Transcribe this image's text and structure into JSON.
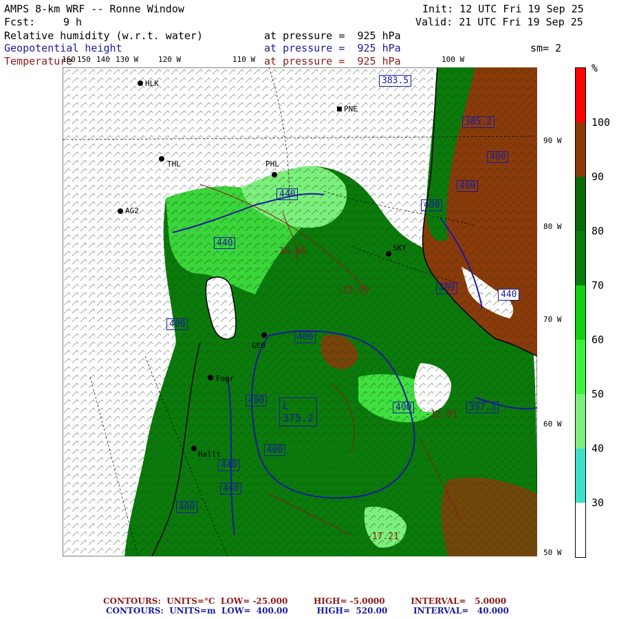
{
  "header": {
    "title": "AMPS 8-km WRF -- Ronne Window",
    "forecast_label": "Fcst:",
    "forecast_hours": "9 h",
    "init": "Init: 12 UTC Fri 19 Sep 25",
    "valid": "Valid: 21 UTC Fri 19 Sep 25",
    "smoothing": "sm= 2",
    "fields": [
      {
        "name": "Relative humidity (w.r.t. water)",
        "level": "at pressure =  925 hPa",
        "color": "#000000"
      },
      {
        "name": "Geopotential height",
        "level": "at pressure =  925 hPa",
        "color": "#1a1aa0"
      },
      {
        "name": "Temperature",
        "level": "at pressure =  925 hPa",
        "color": "#8b1a1a"
      }
    ]
  },
  "colorbar": {
    "unit": "%",
    "levels": [
      {
        "label": "30",
        "color": "#ffffff"
      },
      {
        "label": "40",
        "color": "#3fe0c8"
      },
      {
        "label": "50",
        "color": "#7cf07c"
      },
      {
        "label": "60",
        "color": "#3ff03f"
      },
      {
        "label": "70",
        "color": "#12d012"
      },
      {
        "label": "80",
        "color": "#0a7a0a"
      },
      {
        "label": "90",
        "color": "#0a6a0a"
      },
      {
        "label": "100",
        "color": "#8b3a0a"
      },
      {
        "label": "",
        "color": "#ff0000"
      }
    ]
  },
  "lat_labels": [
    "90 W",
    "80 W",
    "70 W",
    "60 W",
    "50 W"
  ],
  "lon_labels": [
    "160",
    "150",
    "140",
    "130 W",
    "120 W",
    "110 W",
    "100 W"
  ],
  "stations": [
    "HLK",
    "PNE",
    "THL",
    "PHL",
    "AG2",
    "SKY",
    "GEO",
    "Fogr",
    "Hallt"
  ],
  "height_labels": [
    "383.5",
    "385.2",
    "400",
    "400",
    "400",
    "440",
    "440",
    "440",
    "400",
    "400",
    "400",
    "400",
    "400",
    "400",
    "440",
    "440",
    "400",
    "397.3",
    "375.2"
  ],
  "temp_labels": [
    "-16.46",
    "-23.09",
    "-12.01",
    "-17.21"
  ],
  "low_label": "L",
  "footer": {
    "temp_contours": "CONTOURS:  UNITS=°C  LOW= -25.000         HIGH= -5.0000         INTERVAL=   5.0000",
    "height_contours": "CONTOURS:  UNITS=m  LOW=  400.00          HIGH=  520.00         INTERVAL=   40.000"
  }
}
